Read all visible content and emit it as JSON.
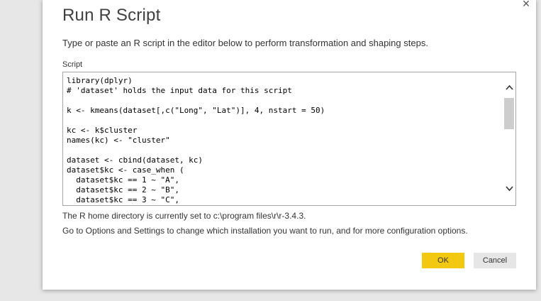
{
  "dialog": {
    "title": "Run R Script",
    "subtitle": "Type or paste an R script in the editor below to perform transformation and shaping steps.",
    "script_label": "Script",
    "script_lines": "library(dplyr)\n# 'dataset' holds the input data for this script\n\nk <- kmeans(dataset[,c(\"Long\", \"Lat\")], 4, nstart = 50)\n\nkc <- k$cluster\nnames(kc) <- \"cluster\"\n\ndataset <- cbind(dataset, kc)\ndataset$kc <- case_when (\n  dataset$kc == 1 ~ \"A\",\n  dataset$kc == 2 ~ \"B\",\n  dataset$kc == 3 ~ \"C\",",
    "info_home": "The R home directory is currently set to c:\\program files\\r\\r-3.4.3.",
    "info_options": "Go to Options and Settings to change which installation you want to run, and for more configuration options.",
    "ok_label": "OK",
    "cancel_label": "Cancel",
    "close_glyph": "×"
  },
  "colors": {
    "ok_button": "#f2c811",
    "cancel_button": "#e6e6e6",
    "scroll_thumb": "#cdcdcd"
  },
  "icons": {
    "close": "close-icon",
    "scroll_up": "chevron-up-icon",
    "scroll_down": "chevron-down-icon"
  }
}
